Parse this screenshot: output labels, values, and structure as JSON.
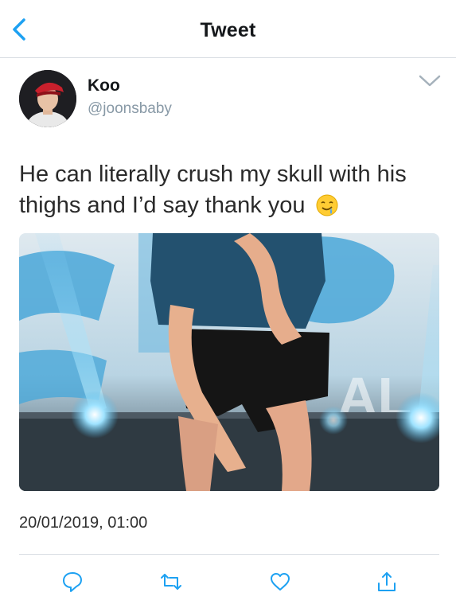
{
  "nav": {
    "title": "Tweet",
    "back_icon": "chevron-left-icon"
  },
  "tweet": {
    "author_name": "Koo",
    "author_handle": "@joonsbaby",
    "text": "He can literally crush my skull with his thighs and I’d say thank you",
    "emoji": "drooling-face-icon",
    "timestamp": "20/01/2019, 01:00"
  },
  "actions": [
    "reply-icon",
    "retweet-icon",
    "like-icon",
    "share-icon"
  ],
  "colors": {
    "accent": "#1da1f2",
    "secondary_text": "#8899a6"
  }
}
